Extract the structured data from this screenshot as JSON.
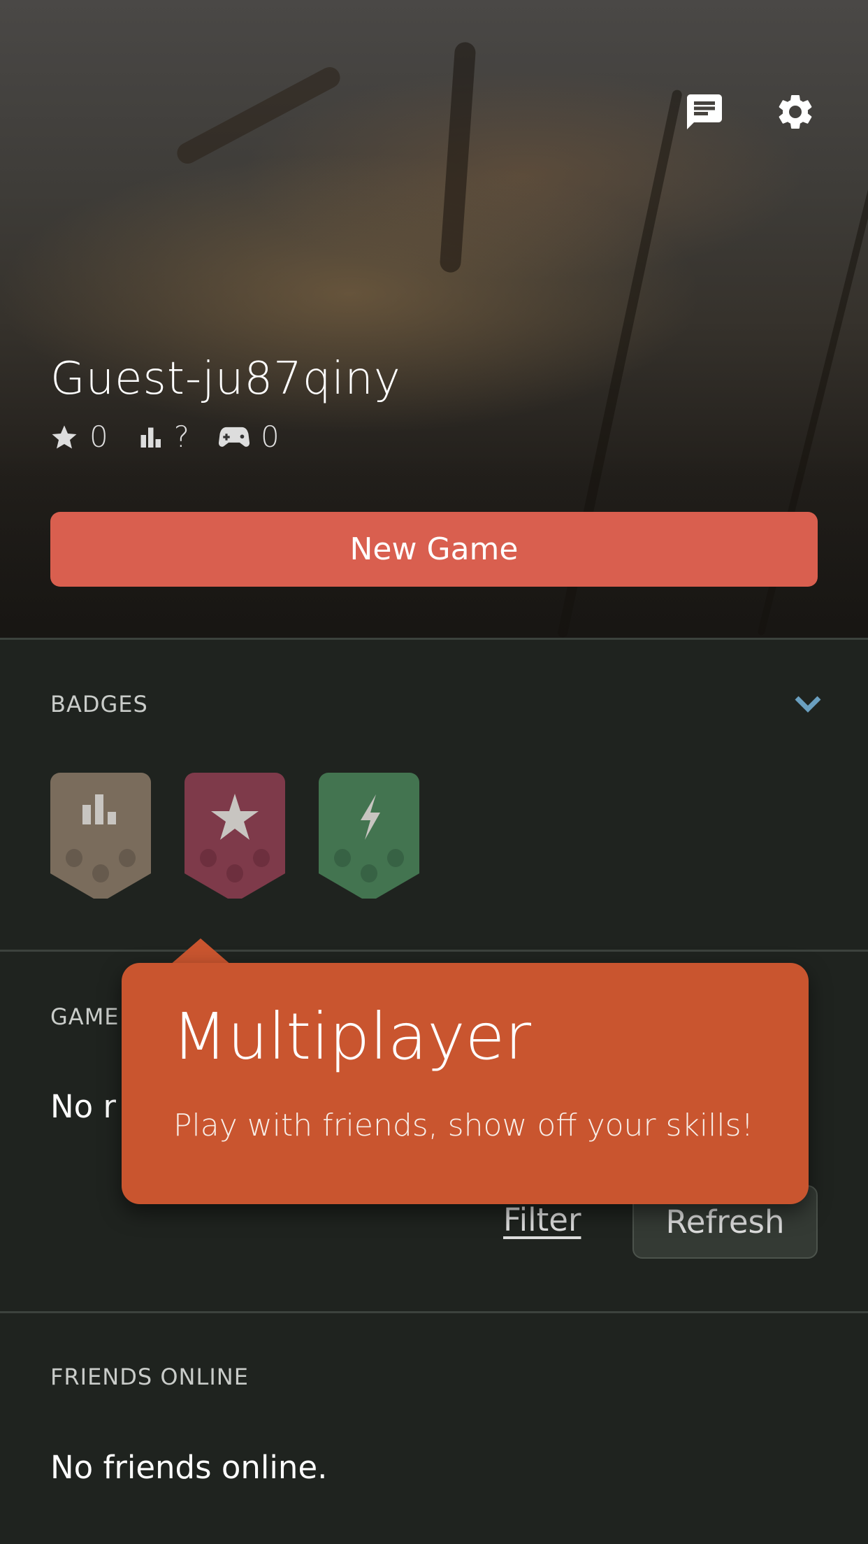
{
  "header": {
    "chat_icon": "chat-bubble-icon",
    "settings_icon": "gear-icon"
  },
  "profile": {
    "username": "Guest-ju87qiny",
    "stats": [
      {
        "icon": "star-icon",
        "value": "0"
      },
      {
        "icon": "bar-chart-icon",
        "value": "?"
      },
      {
        "icon": "gamepad-icon",
        "value": "0"
      }
    ],
    "new_game_label": "New Game"
  },
  "badges": {
    "title": "BADGES",
    "items": [
      {
        "icon": "bar-chart-icon",
        "color": "#7a6c5c"
      },
      {
        "icon": "star-icon",
        "color": "#7e3a4a"
      },
      {
        "icon": "lightning-icon",
        "color": "#437450"
      }
    ]
  },
  "games": {
    "title": "GAME",
    "empty_text": "No r",
    "filter_label": "Filter",
    "refresh_label": "Refresh"
  },
  "tooltip": {
    "title": "Multiplayer",
    "subtitle": "Play with friends, show off your skills!",
    "color": "#c9552f"
  },
  "friends": {
    "title": "FRIENDS ONLINE",
    "empty_text": "No friends online."
  },
  "colors": {
    "accent": "#d95f4f",
    "background": "#1f231f",
    "chevron": "#6a9fbf"
  }
}
